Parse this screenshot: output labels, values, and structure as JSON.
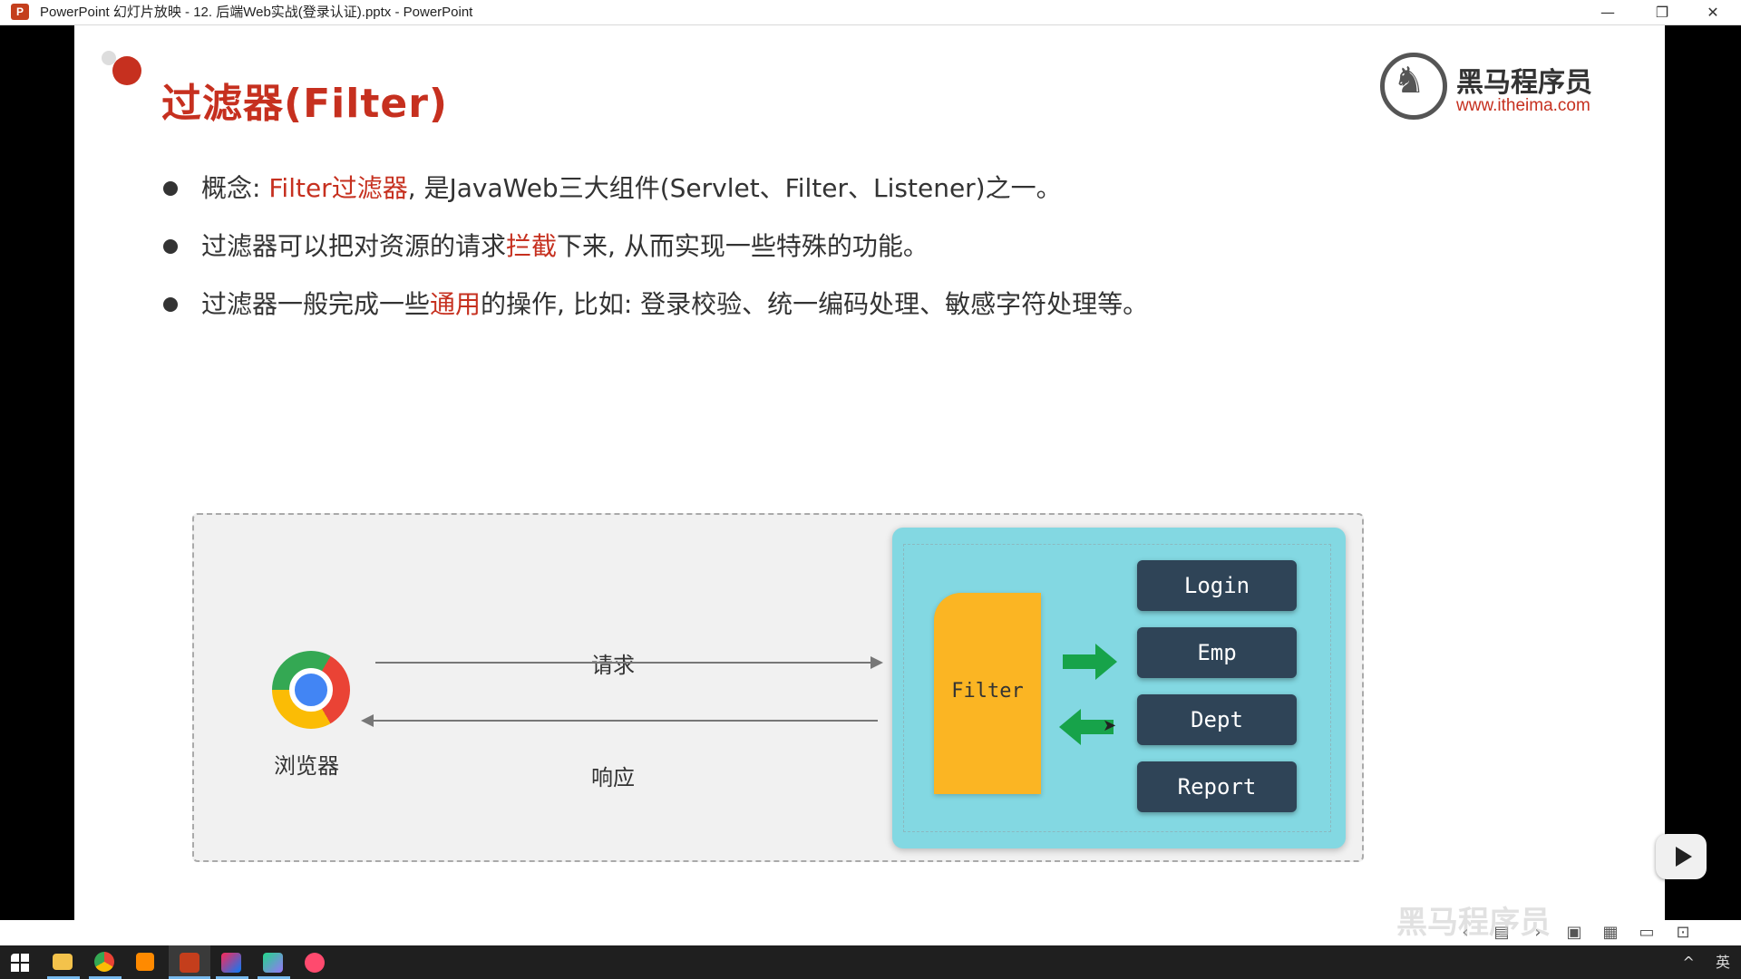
{
  "window": {
    "app_icon_letter": "P",
    "title": "PowerPoint 幻灯片放映  -  12. 后端Web实战(登录认证).pptx - PowerPoint",
    "minimize": "—",
    "restore": "❐",
    "close": "✕"
  },
  "slide": {
    "title": "过滤器(Filter)",
    "logo": {
      "name": "黑马程序员",
      "url": "www.itheima.com"
    },
    "bullets": [
      {
        "pre": "概念: ",
        "highlight": "Filter过滤器",
        "post": ", 是JavaWeb三大组件(Servlet、Filter、Listener)之一。"
      },
      {
        "pre": "过滤器可以把对资源的请求",
        "highlight": "拦截",
        "post": "下来, 从而实现一些特殊的功能。"
      },
      {
        "pre": "过滤器一般完成一些",
        "highlight": "通用",
        "post": "的操作, 比如: 登录校验、统一编码处理、敏感字符处理等。"
      }
    ],
    "diagram": {
      "browser_label": "浏览器",
      "request_label": "请求",
      "response_label": "响应",
      "filter_label": "Filter",
      "services": [
        "Login",
        "Emp",
        "Dept",
        "Report"
      ]
    }
  },
  "colors": {
    "accent_red": "#c6301f",
    "server_bg": "#83d8e2",
    "filter_bg": "#fbb523",
    "service_bg": "#2f4457",
    "arrow_green": "#17a34a"
  },
  "overlay": {
    "watermark": "黑马程序员"
  },
  "taskbar": {
    "tray_lang": "英",
    "tray_caret": "^"
  }
}
